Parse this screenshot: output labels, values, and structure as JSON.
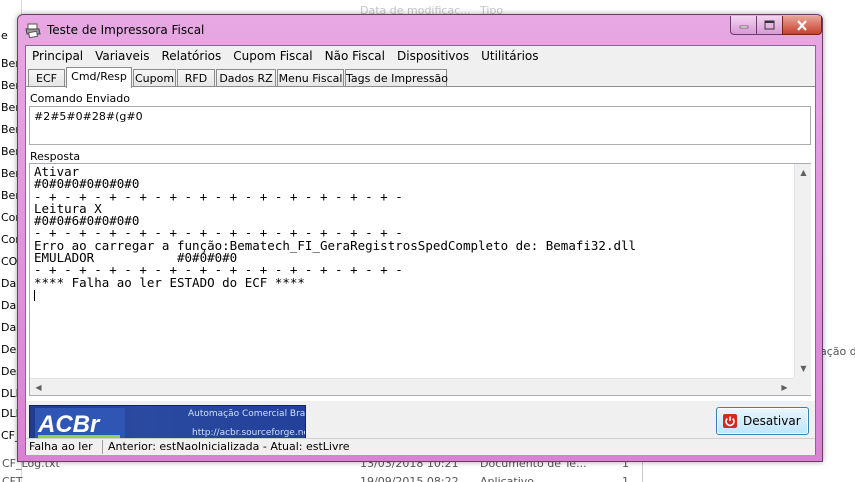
{
  "background": {
    "left_items": [
      "e",
      "Bem",
      "Bem",
      "Bem",
      "Bem",
      "Bem",
      "Bem",
      "Bem",
      "Con",
      "Con",
      "CON",
      "Daru",
      "Daru",
      "Daru",
      "DelZ",
      "Dess",
      "DLL",
      "DLL",
      "CF_",
      "CF_Log.txt",
      "CFT"
    ],
    "right_text": "ação d",
    "faint_top_1": "Data de modificaç...",
    "faint_top_2": "Tipo",
    "rows": [
      {
        "name": "CF_Log.txt",
        "date": "13/03/2018 10:21",
        "type": "Documento de Te...",
        "size": "1"
      },
      {
        "name": "CFT...",
        "date": "19/09/2015 08:22",
        "type": "Aplicativo",
        "size": "1"
      }
    ]
  },
  "window": {
    "title": "Teste de Impressora Fiscal",
    "icon": "printer-icon"
  },
  "menu": [
    "Principal",
    "Variaveis",
    "Relatórios",
    "Cupom Fiscal",
    "Não Fiscal",
    "Dispositivos",
    "Utilitários"
  ],
  "tabs": [
    "ECF",
    "Cmd/Resp",
    "Cupom",
    "RFD",
    "Dados RZ",
    "Menu Fiscal",
    "Tags de Impressão"
  ],
  "active_tab": "Cmd/Resp",
  "command": {
    "label": "Comando Enviado",
    "value": "#2#5#0#28#(g#0"
  },
  "response": {
    "label": "Resposta",
    "lines": [
      "Ativar",
      "#0#0#0#0#0#0#0",
      "- + - + - + - + - + - + - + - + - + - + - + - + -",
      "Leitura X",
      "#0#0#6#0#0#0#0",
      "- + - + - + - + - + - + - + - + - + - + - + - + -",
      "Erro ao carregar a função:Bematech_FI_GeraRegistrosSpedCompleto de: Bemafi32.dll",
      "EMULADOR           #0#0#0#0",
      "- + - + - + - + - + - + - + - + - + - + - + - + -",
      "**** Falha ao ler ESTADO do ECF ****"
    ]
  },
  "banner": {
    "logo_text": "ACBr",
    "line1": "Automação Comercial Brasil",
    "line2": "http://acbr.sourceforge.net"
  },
  "button": {
    "label": "Desativar",
    "icon": "power-icon"
  },
  "status": {
    "left": "Falha ao ler",
    "right": "Anterior: estNaoInicializada - Atual: estLivre"
  },
  "colors": {
    "title_bar": "#e39ee0",
    "close_button": "#c8412c",
    "banner": "#23409a"
  }
}
